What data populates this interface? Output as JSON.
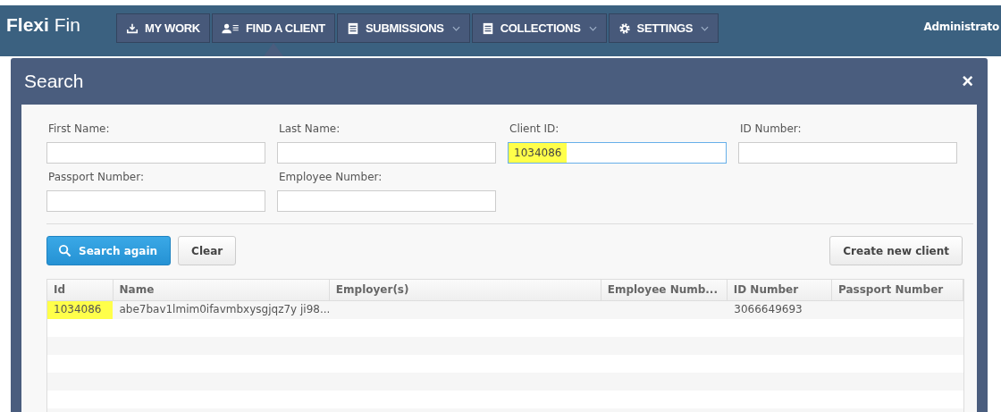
{
  "app": {
    "logo_bold": "Flexi",
    "logo_light": "Fin",
    "user": "Administrato"
  },
  "nav": [
    {
      "label": "MY WORK",
      "kind": "download",
      "dropdown": false,
      "selected": false
    },
    {
      "label": "FIND A CLIENT",
      "kind": "person",
      "dropdown": false,
      "selected": true
    },
    {
      "label": "SUBMISSIONS",
      "kind": "document",
      "dropdown": true,
      "selected": false
    },
    {
      "label": "COLLECTIONS",
      "kind": "document",
      "dropdown": true,
      "selected": false
    },
    {
      "label": "SETTINGS",
      "kind": "gear",
      "dropdown": true,
      "selected": false
    }
  ],
  "dialog": {
    "title": "Search",
    "close": "×",
    "fields": [
      {
        "label": "First Name:",
        "focused": false
      },
      {
        "label": "Last Name:",
        "focused": false
      },
      {
        "label": "Client ID:",
        "value": "1034086",
        "focused": true,
        "highlighted": true
      },
      {
        "label": "ID Number:",
        "focused": false
      },
      {
        "label": "Passport Number:",
        "focused": false
      },
      {
        "label": "Employee Number:",
        "focused": false
      }
    ],
    "buttons": [
      {
        "label": "Search again",
        "kind": "primary"
      },
      {
        "label": "Clear",
        "kind": "default"
      }
    ],
    "create_button": "Create new client",
    "table": {
      "columns": [
        "Id",
        "Name",
        "Employer(s)",
        "Employee Numb...",
        "ID Number",
        "Passport Number"
      ],
      "rows": [
        {
          "cells": [
            "1034086",
            "abe7bav1lmim0ifavmbxysgjqz7y ji98...",
            "",
            "",
            "3066649693",
            ""
          ],
          "highlighted": true
        }
      ]
    }
  }
}
